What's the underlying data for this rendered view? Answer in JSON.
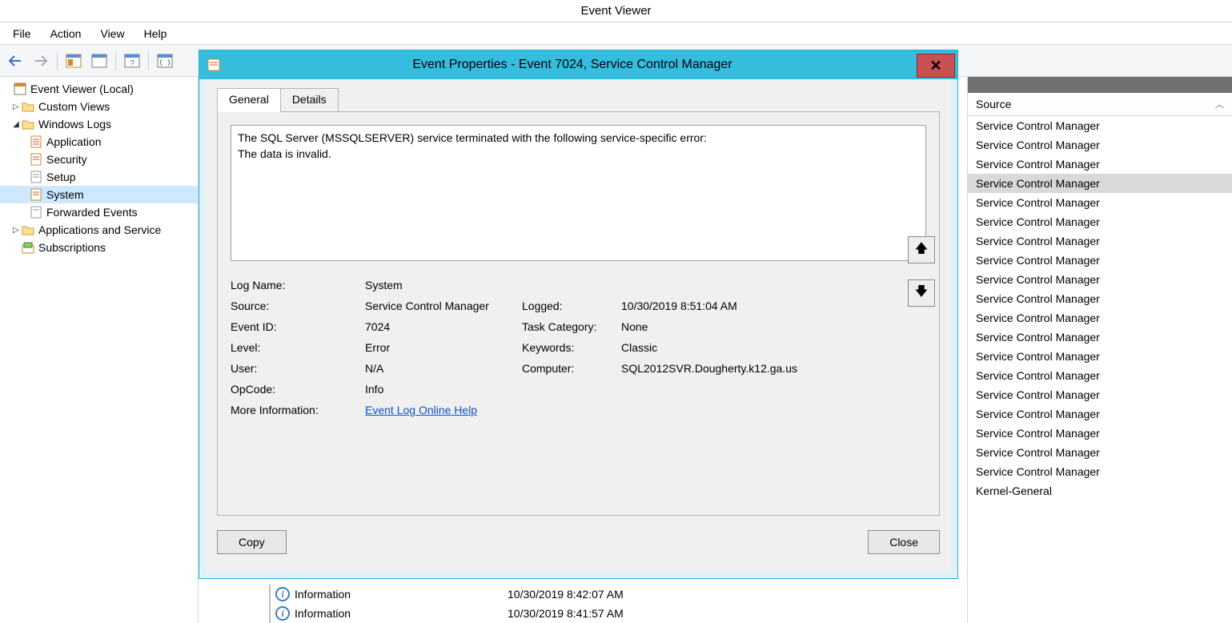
{
  "app": {
    "title": "Event Viewer"
  },
  "menu": {
    "file": "File",
    "action": "Action",
    "view": "View",
    "help": "Help"
  },
  "tree": {
    "root": "Event Viewer (Local)",
    "custom_views": "Custom Views",
    "windows_logs": "Windows Logs",
    "application": "Application",
    "security": "Security",
    "setup": "Setup",
    "system": "System",
    "forwarded": "Forwarded Events",
    "apps_services": "Applications and Service",
    "subscriptions": "Subscriptions"
  },
  "rightlist": {
    "header": "Source",
    "rows": [
      "Service Control Manager",
      "Service Control Manager",
      "Service Control Manager",
      "Service Control Manager",
      "Service Control Manager",
      "Service Control Manager",
      "Service Control Manager",
      "Service Control Manager",
      "Service Control Manager",
      "Service Control Manager",
      "Service Control Manager",
      "Service Control Manager",
      "Service Control Manager",
      "Service Control Manager",
      "Service Control Manager",
      "Service Control Manager",
      "Service Control Manager",
      "Service Control Manager",
      "Service Control Manager",
      "Kernel-General"
    ],
    "selected_index": 3
  },
  "bottom": {
    "row1": {
      "level": "Information",
      "datetime": "10/30/2019 8:42:07 AM"
    },
    "row2": {
      "level": "Information",
      "datetime": "10/30/2019 8:41:57 AM"
    }
  },
  "dialog": {
    "title": "Event Properties - Event 7024, Service Control Manager",
    "tabs": {
      "general": "General",
      "details": "Details"
    },
    "message": "The SQL Server (MSSQLSERVER) service terminated with the following service-specific error:\nThe data is invalid.",
    "props": {
      "log_name_label": "Log Name:",
      "log_name": "System",
      "source_label": "Source:",
      "source": "Service Control Manager",
      "logged_label": "Logged:",
      "logged": "10/30/2019 8:51:04 AM",
      "event_id_label": "Event ID:",
      "event_id": "7024",
      "task_label": "Task Category:",
      "task": "None",
      "level_label": "Level:",
      "level": "Error",
      "keywords_label": "Keywords:",
      "keywords": "Classic",
      "user_label": "User:",
      "user": "N/A",
      "computer_label": "Computer:",
      "computer": "SQL2012SVR.Dougherty.k12.ga.us",
      "opcode_label": "OpCode:",
      "opcode": "Info",
      "moreinfo_label": "More Information:",
      "moreinfo_link": "Event Log Online Help"
    },
    "buttons": {
      "copy": "Copy",
      "close": "Close"
    }
  }
}
